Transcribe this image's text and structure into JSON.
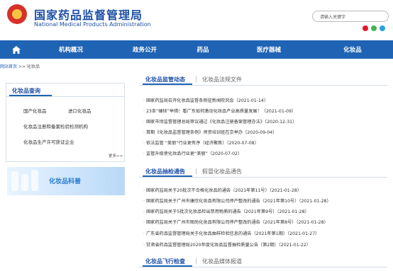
{
  "header": {
    "title_cn": "国家药品监督管理局",
    "title_en": "National Medical Products Administration",
    "search_placeholder": "请输入关键字"
  },
  "nav": {
    "items": [
      "机构概况",
      "政务公开",
      "药品",
      "医疗器械",
      "化妆品"
    ]
  },
  "breadcrumb": {
    "home": "网站首页",
    "sep": ">>",
    "current": "化妆品"
  },
  "left": {
    "title": "化妆品查询",
    "links": [
      "国产化妆品",
      "进口化妆品",
      "化妆品注册和备案检验检测机构",
      "化妆品生产许可获证企业"
    ],
    "more": "更多>>",
    "banner_text": "化妆品科普"
  },
  "section1": {
    "tab_active": "化妆品监管动态",
    "tab_other": "化妆品法规文件",
    "items": [
      "国家药监局召开化妆品监督条例征新闻吹风会（2021-01-14）",
      "23条“硬核”举措！看广东如何激动化妆品产业高质量发展！（2021-01-09）",
      "国家市场监督管理总局审议通过《化妆品注册备案管理办法》（2020-12-31）",
      "首期《化妆品监督管理条例》师资培训班在京举办（2020-09-04）",
      "依法监管 “美丽”行业更有序（经济聚焦）（2020-07-08）",
      "监管升级使化妆品行业更“美丽”（2020-07-02）"
    ]
  },
  "section2": {
    "tab_active": "化妆品抽检通告",
    "tab_other": "假冒化妆品通告",
    "items": [
      "国家药监局关于20批次不合格化妆品的通告（2021年第11号）（2021-01-28）",
      "国家药监局关于广州市康欣化妆品有限公司停产整改的通告（2021年第10号）（2021-01-28）",
      "国家药监局关于5批次化妆品检出禁用物质的通告（2021年第9号）（2021-01-28）",
      "国家药监局关于广州市图尚化妆品有限公司停产整改的通告（2021年第8号）（2021-01-28）",
      "广东省药品监督管理局关于化妆品抽样检验信息的通告（2021年第1期）（2021-01-27）",
      "甘肃省药品监督管理局2020年度化妆品监督抽检质量公告（第2期）（2021-01-22）"
    ]
  },
  "section3": {
    "tab_active": "化妆品飞行检查",
    "tab_other": "化妆品媒体报道"
  },
  "colors": {
    "nav_bg": "#1f63b4",
    "brand_blue": "#1d4fa6"
  }
}
